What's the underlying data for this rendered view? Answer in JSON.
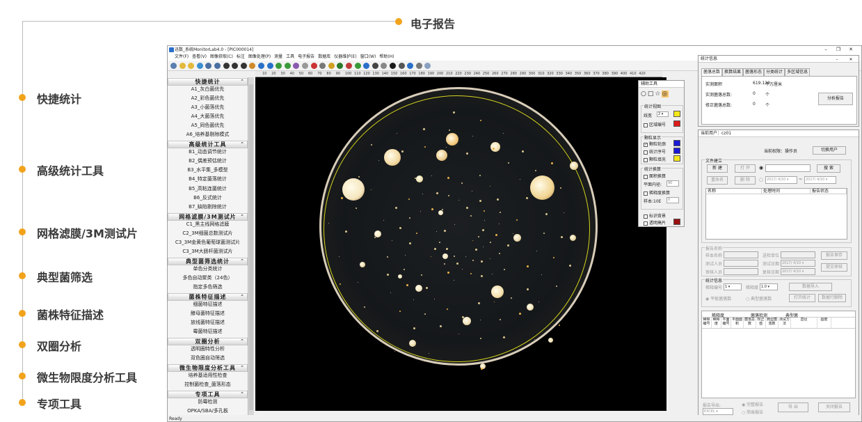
{
  "features": {
    "top_label": "电子报告",
    "left_labels": [
      "快捷统计",
      "高级统计工具",
      "网格滤膜/3M测试片",
      "典型菌筛选",
      "菌株特征描述",
      "双圈分析",
      "微生物限度分析工具",
      "专项工具"
    ]
  },
  "app": {
    "title": "迅数_系统MonitorLab4.0 - [PIC000014]",
    "menu": [
      "文件(F)",
      "查看(V)",
      "图像获取(C)",
      "标注",
      "图像处理(P)",
      "测量",
      "工具",
      "电子报告",
      "数据库",
      "仪器维护(E)",
      "窗口(W)",
      "帮助(H)"
    ],
    "ruler_ticks": [
      "10",
      "20",
      "30",
      "40",
      "50",
      "60",
      "70",
      "80",
      "90",
      "100",
      "110",
      "120",
      "130",
      "140",
      "150",
      "160",
      "170",
      "180",
      "190",
      "200",
      "210",
      "220",
      "230",
      "240",
      "250",
      "260",
      "270",
      "280",
      "290",
      "300",
      "310",
      "320",
      "330",
      "340",
      "350",
      "360",
      "370",
      "380",
      "390",
      "400",
      "410",
      "420"
    ],
    "status": "Ready",
    "colors": {
      "accent": "#f2a31c",
      "swatch_yellow": "#f5e81a",
      "swatch_red": "#e01b1b",
      "swatch_blue": "#1a1ad6"
    }
  },
  "sidebar": {
    "sections": [
      {
        "title": "快捷统计",
        "items": [
          "A1_灰白菌优先",
          "A2_彩色菌优先",
          "A3_小菌落优先",
          "A4_大菌落优先",
          "A5_同色菌优先",
          "A6_培养基剔除模式"
        ]
      },
      {
        "title": "高级统计工具",
        "items": [
          "B1_动态调节统计",
          "B2_偶差预估统计",
          "B3_水平集_多模型",
          "B4_特定菌落统计",
          "B5_高粘连菌统计",
          "B6_反式统计",
          "B7_缺陷剔除统计"
        ]
      },
      {
        "title": "网格滤膜/3M测试片",
        "items": [
          "C1_黑主线网格滤膜",
          "C2_3M细菌总数测试片",
          "C3_3M金黄色葡萄球菌测试片",
          "C3_3M大肠杆菌测试片"
        ]
      },
      {
        "title": "典型菌筛选统计",
        "items": [
          "单色分类统计",
          "多色自动聚类（24色）",
          "指定多色筛选"
        ]
      },
      {
        "title": "菌株特征描述",
        "items": [
          "细菌特征描述",
          "酵母菌特征描述",
          "放线菌特征描述",
          "霉菌特征描述"
        ]
      },
      {
        "title": "双圈分析",
        "items": [
          "透明圈特性分析",
          "双色圈自动筛选"
        ]
      },
      {
        "title": "微生物限度分析工具",
        "items": [
          "培养基适用性检查",
          "控制菌检查_菌落形态"
        ]
      },
      {
        "title": "专项工具",
        "items": [
          "防霉检测",
          "OPKA/SBA/多孔板"
        ]
      }
    ]
  },
  "assist": {
    "title": "辅助工具",
    "stats_view": "统计视图",
    "line_width_label": "线宽",
    "line_width_value": "2",
    "region_number": "区域编号",
    "particle_display": "颗粒显示",
    "particle_outline": "颗粒轮廓",
    "stats_order": "统计序号",
    "particle_fill": "颗粒填充",
    "calc": "统计换算",
    "area_calc": "面积换算",
    "plane_diameter": "平面内径:",
    "plane_diameter_value": "90",
    "dilution_calc": "稀释度换算",
    "sample_label": "样本:10E",
    "sample_value": "0",
    "mark_bg": "标识背景",
    "transparent_mask": "透明掩片"
  },
  "stats": {
    "title": "统计信息",
    "tabs": [
      "菌落总数",
      "换算结果",
      "菌落形态",
      "分类统计",
      "多区域信息"
    ],
    "rows": [
      {
        "label": "实测面积",
        "value": "619.120",
        "unit": "平方厘米"
      },
      {
        "label": "实测菌落总数:",
        "value": "0",
        "unit": "个"
      },
      {
        "label": "修正菌落总数:",
        "value": "0",
        "unit": "个"
      }
    ],
    "analyze_button": "分析报告"
  },
  "report": {
    "title": "当前用户：cz01",
    "perm_label": "当前权限：操作员",
    "switch_user": "切换用户",
    "file_create": "文件建立",
    "new_btn": "新 建",
    "open_btn": "打 开",
    "rename_btn": "重命名",
    "delete_btn": "删 除",
    "search_btn": "搜 索",
    "date_from": "2017/ 4/10",
    "date_to": "2017/ 4/10",
    "date_sep": "~",
    "file_cols": [
      "名称",
      "处理时间",
      "报告状态"
    ],
    "report_name": "报告名称",
    "sample_name": "样本名称",
    "send_unit": "送检单位",
    "tester": "测试人员",
    "test_date": "测试日期",
    "reviewer": "审核人员",
    "review_date": "复核日期",
    "date_val": "2017/ 4/10",
    "save_report": "报告保存",
    "submit_review": "提交审核",
    "stat_info": "统计信息",
    "dilution_no": "稀释编号",
    "dilution_no_val": "1",
    "dilution": "稀释度",
    "dilution_val": "1.0",
    "data_import": "数据导入",
    "plate_total": "平板菌落数",
    "typical_total": "典型菌落数",
    "open_stats": "打开统计",
    "delete_data": "数据行删除",
    "table_group_headers": [
      "稀释度",
      "菌落检测",
      "典型菌"
    ],
    "table_cols": [
      "稀释编号",
      "稀释度",
      "平面编号",
      "平面面积",
      "菌落总数",
      "校正值",
      "典型菌落数",
      "测试方法",
      "直径",
      "圆度"
    ],
    "export_label": "报告导出:",
    "export_format": "EXCEL",
    "full_report": "完整报告",
    "brief_report": "简易报告",
    "export_btn": "导 出",
    "close_btn": "关闭报告"
  }
}
